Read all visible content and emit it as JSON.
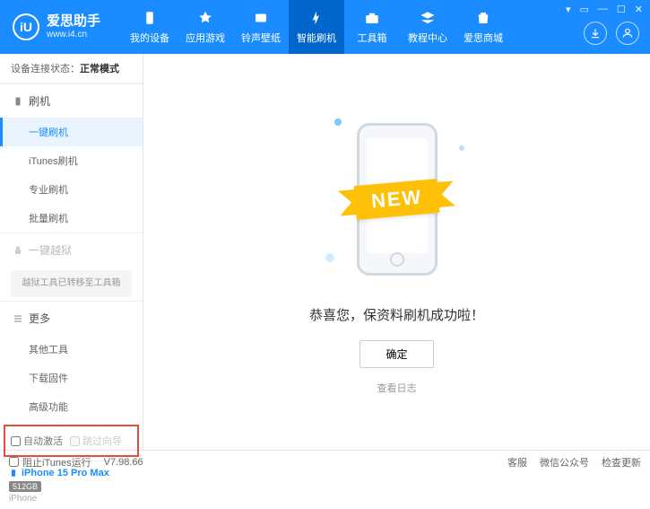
{
  "header": {
    "logo_letter": "iU",
    "title": "爱思助手",
    "url": "www.i4.cn",
    "nav": [
      {
        "label": "我的设备"
      },
      {
        "label": "应用游戏"
      },
      {
        "label": "铃声壁纸"
      },
      {
        "label": "智能刷机"
      },
      {
        "label": "工具箱"
      },
      {
        "label": "教程中心"
      },
      {
        "label": "爱思商城"
      }
    ]
  },
  "sidebar": {
    "status_prefix": "设备连接状态：",
    "status_value": "正常模式",
    "group_flash": "刷机",
    "items_flash": [
      "一键刷机",
      "iTunes刷机",
      "专业刷机",
      "批量刷机"
    ],
    "group_jailbreak": "一键越狱",
    "jailbreak_note": "越狱工具已转移至工具箱",
    "group_more": "更多",
    "items_more": [
      "其他工具",
      "下载固件",
      "高级功能"
    ],
    "cb_auto": "自动激活",
    "cb_skip": "跳过向导",
    "device_name": "iPhone 15 Pro Max",
    "device_storage": "512GB",
    "device_type": "iPhone"
  },
  "main": {
    "banner": "NEW",
    "message": "恭喜您，保资料刷机成功啦！",
    "ok": "确定",
    "log": "查看日志"
  },
  "footer": {
    "block_itunes": "阻止iTunes运行",
    "version": "V7.98.66",
    "links": [
      "客服",
      "微信公众号",
      "检查更新"
    ]
  }
}
